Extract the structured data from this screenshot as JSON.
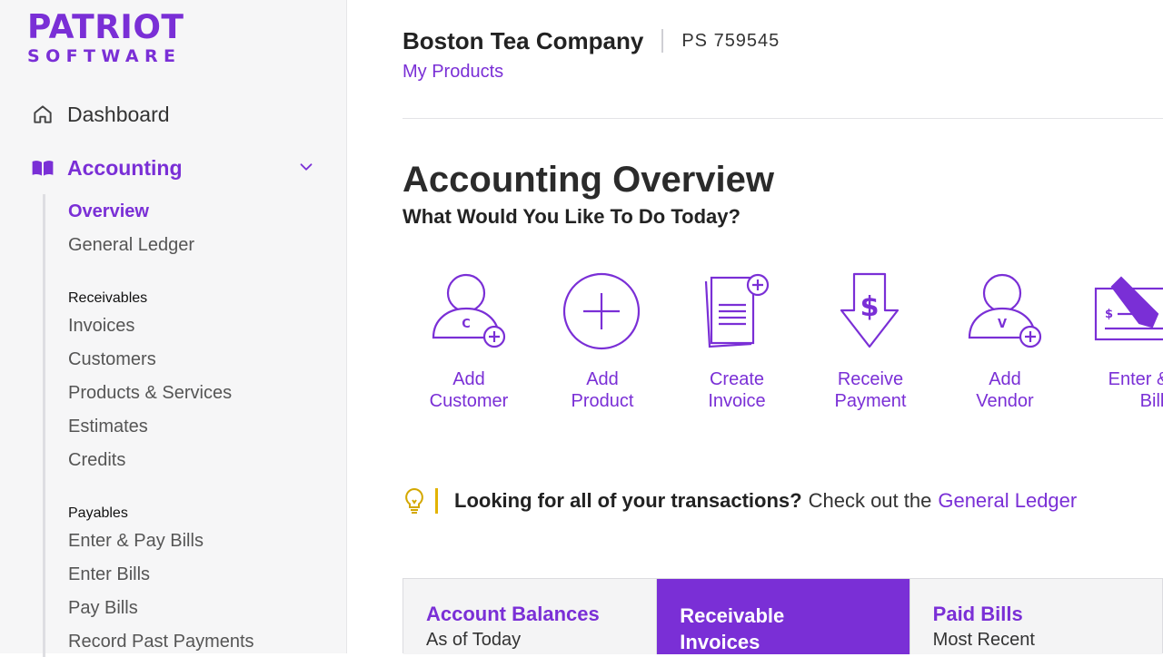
{
  "logo": {
    "line1": "PATRIOT",
    "line2": "SOFTWARE"
  },
  "nav": {
    "dashboard": "Dashboard",
    "accounting": "Accounting",
    "sub": {
      "overview": "Overview",
      "general_ledger": "General Ledger",
      "receivables_header": "Receivables",
      "invoices": "Invoices",
      "customers": "Customers",
      "products_services": "Products & Services",
      "estimates": "Estimates",
      "credits": "Credits",
      "payables_header": "Payables",
      "enter_pay_bills": "Enter & Pay Bills",
      "enter_bills": "Enter Bills",
      "pay_bills": "Pay Bills",
      "record_past_payments": "Record Past Payments"
    }
  },
  "header": {
    "company": "Boston Tea Company",
    "company_id": "PS 759545",
    "my_products": "My Products"
  },
  "main": {
    "title": "Accounting Overview",
    "subtitle": "What Would You Like To Do Today?",
    "actions": [
      {
        "line1": "Add",
        "line2": "Customer",
        "icon": "add-customer-icon"
      },
      {
        "line1": "Add",
        "line2": "Product",
        "icon": "add-product-icon"
      },
      {
        "line1": "Create",
        "line2": "Invoice",
        "icon": "create-invoice-icon"
      },
      {
        "line1": "Receive",
        "line2": "Payment",
        "icon": "receive-payment-icon"
      },
      {
        "line1": "Add",
        "line2": "Vendor",
        "icon": "add-vendor-icon"
      },
      {
        "line1": "Enter & Pay",
        "line2": "Bills",
        "icon": "enter-pay-bills-icon"
      }
    ],
    "tip": {
      "strong": "Looking for all of your transactions?",
      "text": "Check out the",
      "link": "General Ledger"
    },
    "cards": [
      {
        "title": "Account Balances",
        "subtitle": "As of Today"
      },
      {
        "title": "Receivable Invoices",
        "title_line1": "Receivable",
        "title_line2": "Invoices"
      },
      {
        "title": "Paid Bills",
        "subtitle": "Most Recent"
      }
    ]
  },
  "colors": {
    "accent": "#7a2fd6",
    "tip_bar": "#e3b300",
    "tip_icon": "#d4a800"
  }
}
